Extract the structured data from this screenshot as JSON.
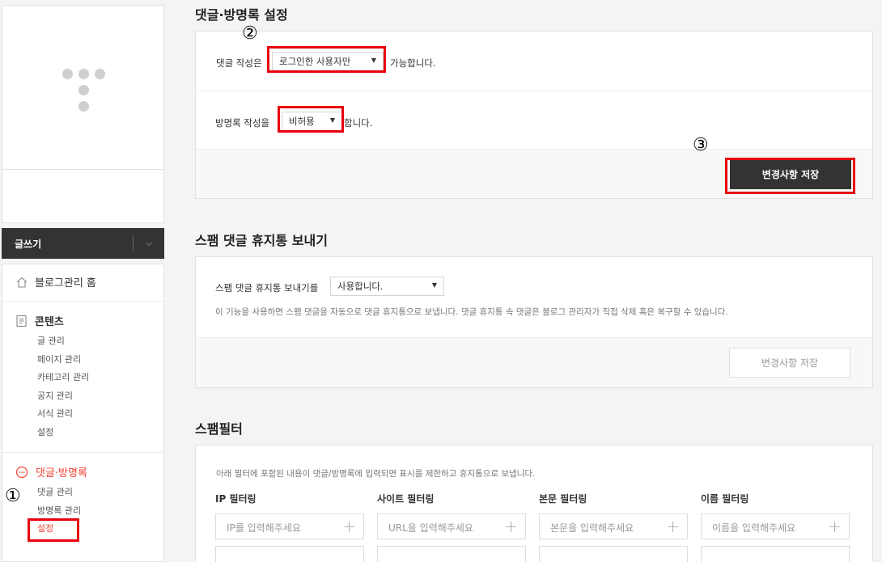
{
  "sidebar": {
    "write_label": "글쓰기",
    "home_label": "블로그관리 홈",
    "contents": {
      "label": "콘텐츠",
      "items": [
        "글 관리",
        "페이지 관리",
        "카테고리 관리",
        "공지 관리",
        "서식 관리",
        "설정"
      ]
    },
    "comments": {
      "label": "댓글·방명록",
      "items": [
        "댓글 관리",
        "방명록 관리",
        "설정"
      ]
    }
  },
  "comment_settings": {
    "title": "댓글·방명록 설정",
    "comment_prefix": "댓글 작성은",
    "comment_value": "로그인한 사용자만",
    "comment_suffix": "가능합니다.",
    "guestbook_prefix": "방명록 작성을",
    "guestbook_value": "비허용",
    "guestbook_suffix": "합니다.",
    "save_label": "변경사항 저장"
  },
  "spam_trash": {
    "title": "스팸 댓글 휴지통 보내기",
    "row_label": "스팸 댓글 휴지통 보내기를",
    "value": "사용합니다.",
    "description": "이 기능을 사용하면 스팸 댓글을 자동으로 댓글 휴지통으로 보냅니다. 댓글 휴지통 속 댓글은 블로그 관리자가 직접 삭제 혹은 복구할 수 있습니다.",
    "save_label": "변경사항 저장"
  },
  "spam_filter": {
    "title": "스팸필터",
    "description": "아래 필터에 포함된 내용이 댓글/방명록에 입력되면 표시를 제한하고 휴지통으로 보냅니다.",
    "filters": [
      {
        "label": "IP 필터링",
        "placeholder": "IP를 입력해주세요"
      },
      {
        "label": "사이트 필터링",
        "placeholder": "URL을 입력해주세요"
      },
      {
        "label": "본문 필터링",
        "placeholder": "본문을 입력해주세요"
      },
      {
        "label": "이름 필터링",
        "placeholder": "이름을 입력해주세요"
      }
    ]
  },
  "annotations": {
    "step1": "①",
    "step2": "②",
    "step3": "③"
  },
  "colors": {
    "accent_red": "#f44336",
    "highlight_red": "#e8000e",
    "dark_button": "#333333"
  }
}
